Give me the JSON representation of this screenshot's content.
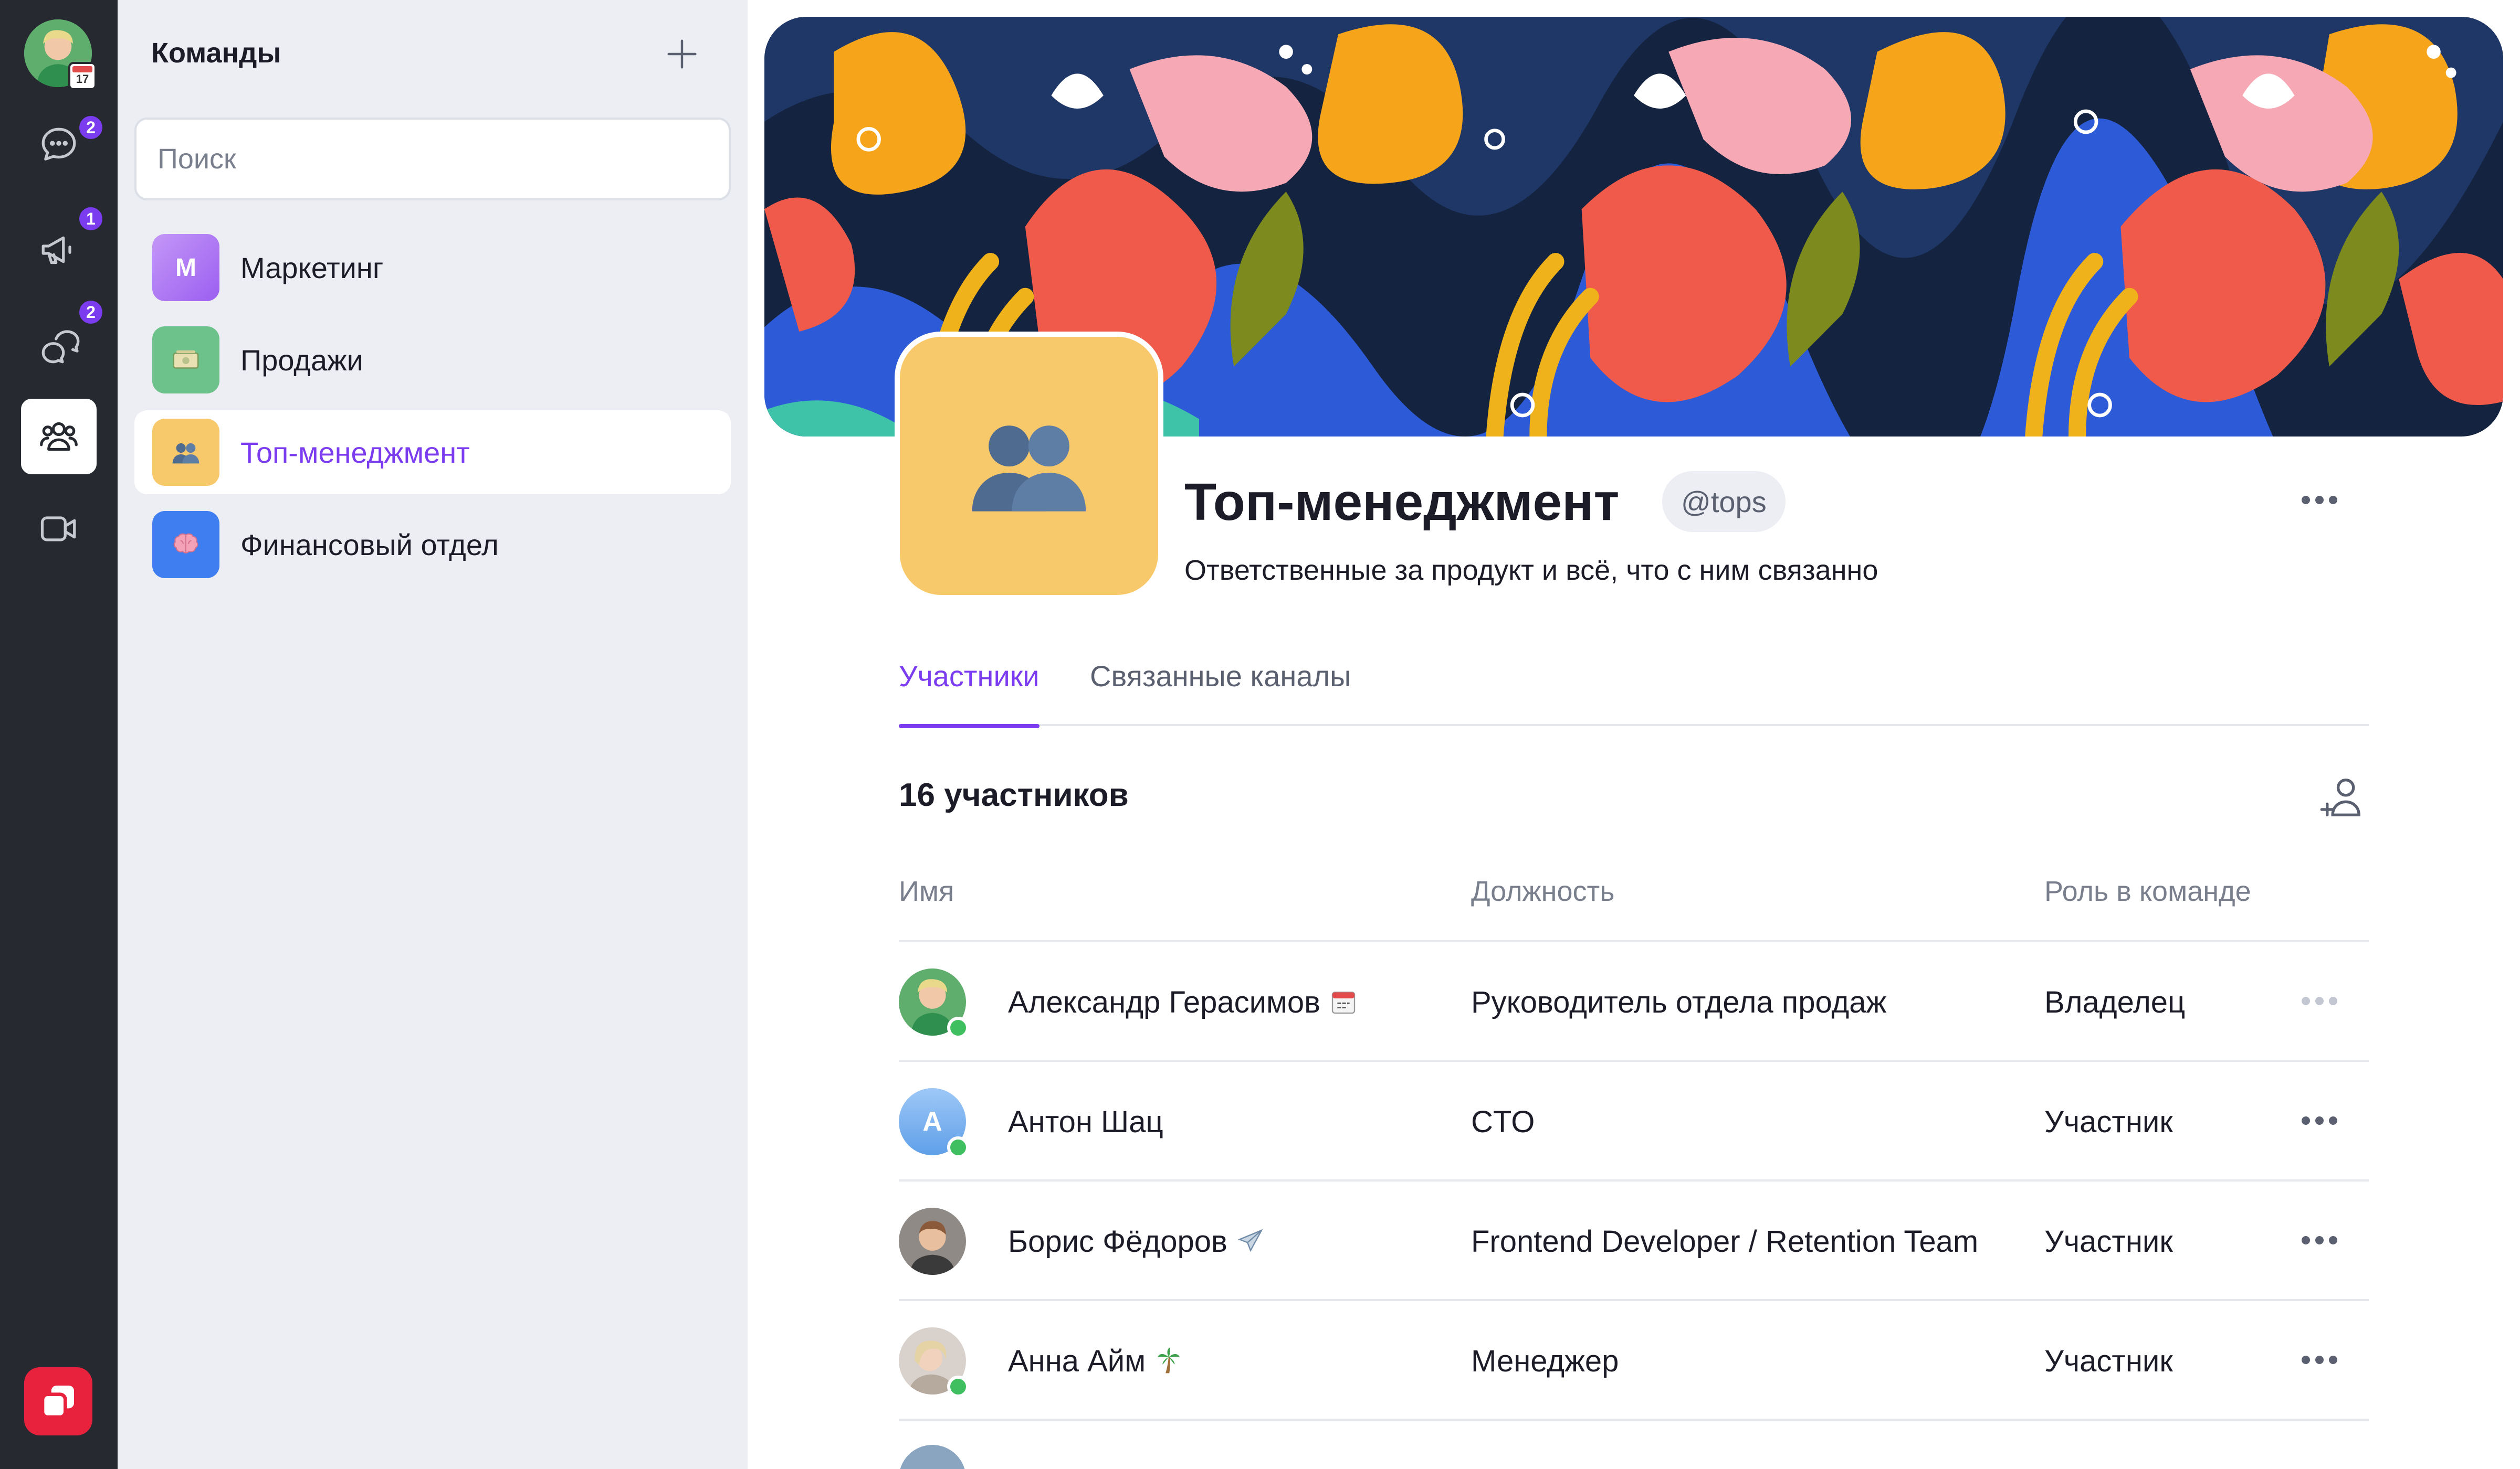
{
  "rail": {
    "calendar_day": "17",
    "chats_badge": "2",
    "announcements_badge": "1",
    "threads_badge": "2"
  },
  "panel": {
    "title": "Команды",
    "search_placeholder": "Поиск",
    "teams": [
      {
        "name": "Маркетинг",
        "icon_letter": "М",
        "color": "#b57cf0",
        "active": false
      },
      {
        "name": "Продажи",
        "icon": "money-icon",
        "color": "#6cc28a",
        "active": false
      },
      {
        "name": "Топ-менеджмент",
        "icon": "people-icon",
        "color": "#f8c96a",
        "active": true
      },
      {
        "name": "Финансовый отдел",
        "icon": "brain-icon",
        "color": "#3f7ef0",
        "active": false
      }
    ]
  },
  "main": {
    "title": "Топ-менеджмент",
    "handle": "@tops",
    "description": "Ответственные за продукт и всё, что с ним связанно",
    "tabs": [
      {
        "label": "Участники",
        "active": true
      },
      {
        "label": "Связанные каналы",
        "active": false
      }
    ],
    "members_count": "16 участников",
    "columns": {
      "name": "Имя",
      "position": "Должность",
      "role": "Роль в команде"
    },
    "members": [
      {
        "initial": "",
        "name": "Александр Герасимов",
        "status_icon": "calendar-icon",
        "position": "Руководитель отдела продаж",
        "role": "Владелец",
        "online": true
      },
      {
        "initial": "A",
        "name": "Антон Шац",
        "status_icon": "",
        "position": "CTO",
        "role": "Участник",
        "online": true
      },
      {
        "initial": "",
        "name": "Борис Фёдоров",
        "status_icon": "airplane-icon",
        "position": "Frontend Developer / Retention Team",
        "role": "Участник",
        "online": false
      },
      {
        "initial": "",
        "name": "Анна Айм",
        "status_icon": "palm-tree-icon",
        "position": "Менеджер",
        "role": "Участник",
        "online": true
      }
    ]
  },
  "colors": {
    "accent": "#7b3cf0",
    "rail_bg": "#26292f",
    "panel_bg": "#eceef3",
    "online": "#3fbf5f",
    "logo": "#e8213d"
  }
}
